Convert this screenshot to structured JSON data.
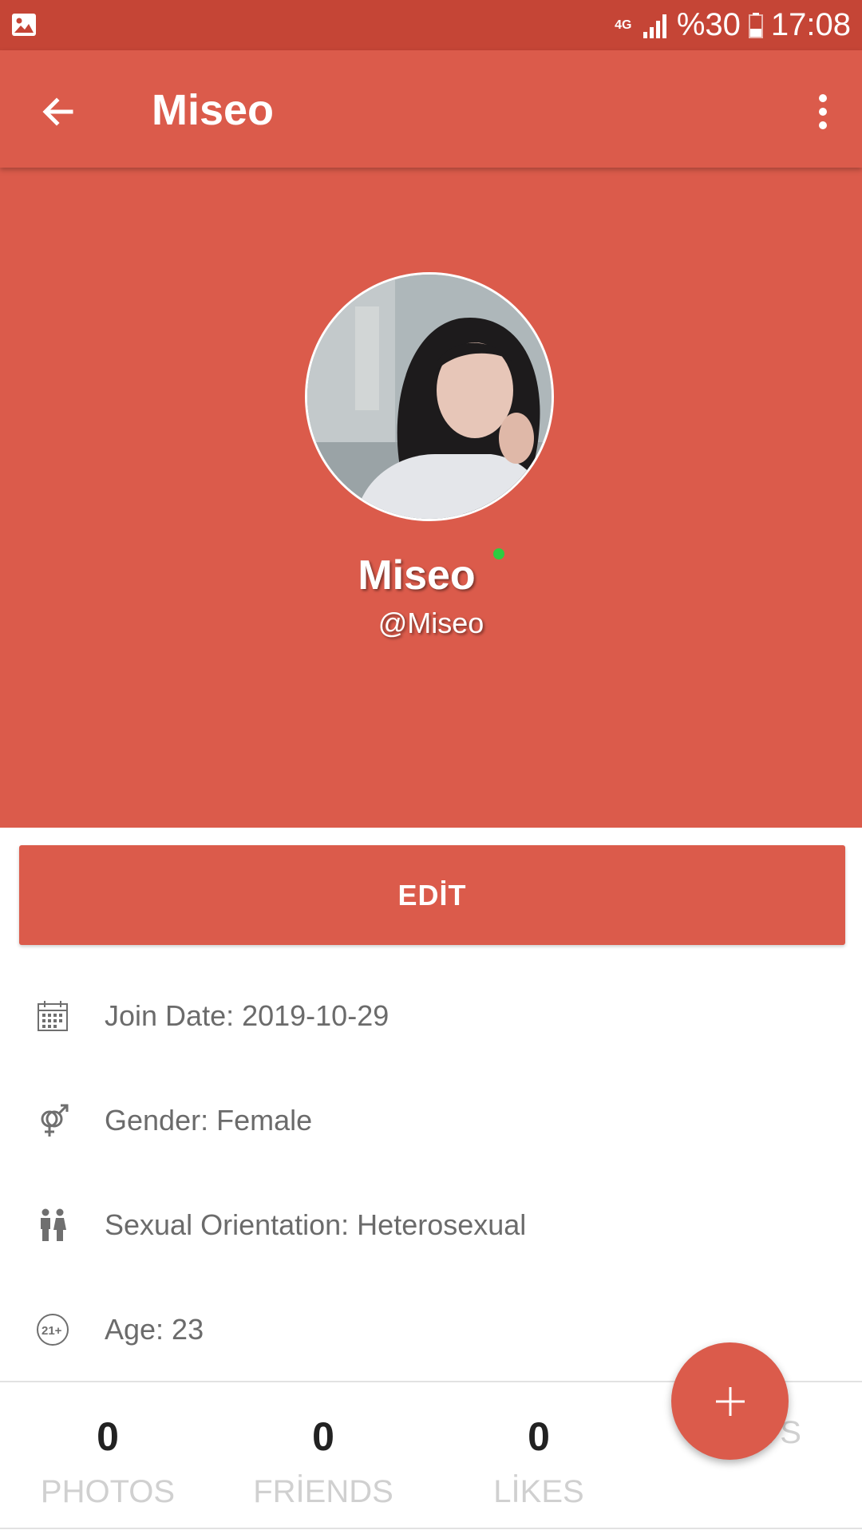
{
  "status_bar": {
    "network": "4G",
    "battery": "%30",
    "time": "17:08",
    "icons": [
      "gallery-icon",
      "signal-icon",
      "battery-icon"
    ]
  },
  "toolbar": {
    "title": "Miseo",
    "back_icon": "arrow-left-icon",
    "more_icon": "more-vertical-icon"
  },
  "profile": {
    "display_name": "Miseo",
    "username": "@Miseo",
    "online": true
  },
  "edit_button": {
    "label": "EDİT"
  },
  "info": [
    {
      "icon": "calendar-icon",
      "text": "Join Date: 2019-10-29"
    },
    {
      "icon": "gender-icon",
      "text": "Gender: Female"
    },
    {
      "icon": "couple-icon",
      "text": "Sexual Orientation: Heterosexual"
    },
    {
      "icon": "age-21-plus-icon",
      "text": "Age: 23"
    }
  ],
  "stats": [
    {
      "count": "0",
      "label": "PHOTOS"
    },
    {
      "count": "0",
      "label": "FRİENDS"
    },
    {
      "count": "0",
      "label": "LİKES"
    },
    {
      "count": "",
      "label": "GİFTS"
    }
  ],
  "fab": {
    "icon": "plus-icon"
  },
  "colors": {
    "primary": "#db5b4b",
    "primary_dark": "#c54536",
    "online": "#2ecc40",
    "text_secondary": "#6b6b6b",
    "stat_label": "#d0d0d0"
  }
}
